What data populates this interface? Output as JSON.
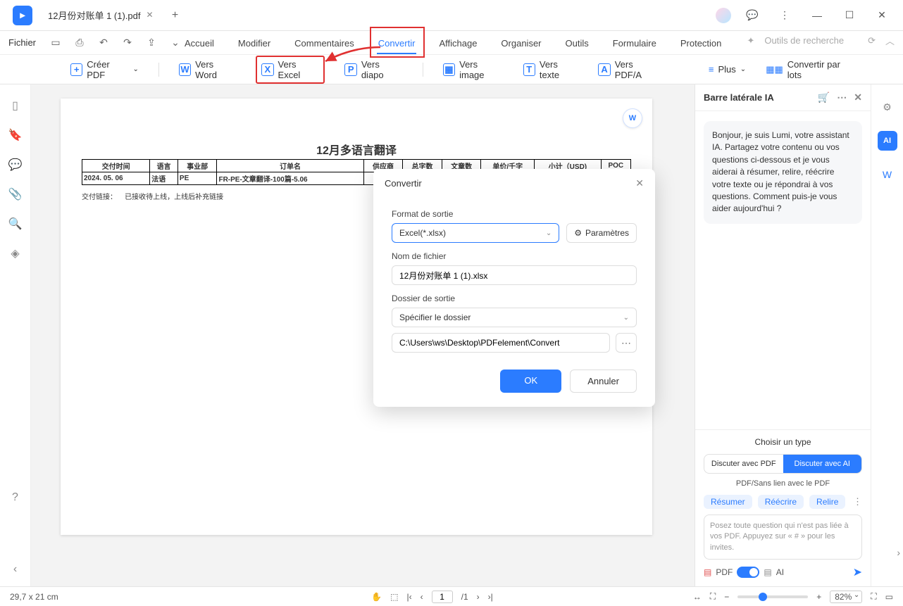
{
  "titlebar": {
    "tab_title": "12月份对账单 1 (1).pdf"
  },
  "quickbar": {
    "fichier": "Fichier"
  },
  "menu": {
    "items": [
      "Accueil",
      "Modifier",
      "Commentaires",
      "Convertir",
      "Affichage",
      "Organiser",
      "Outils",
      "Formulaire",
      "Protection"
    ],
    "active_index": 3,
    "search_placeholder": "Outils de recherche"
  },
  "toolbar": {
    "create": "Créer PDF",
    "word": "Vers Word",
    "excel": "Vers Excel",
    "diapo": "Vers diapo",
    "image": "Vers image",
    "texte": "Vers texte",
    "pdfa": "Vers PDF/A",
    "plus": "Plus",
    "parlots": "Convertir par lots"
  },
  "doc": {
    "title": "12月多语言翻译",
    "headers": [
      "交付时间",
      "语言",
      "事业部",
      "订单名",
      "供应商",
      "总字数",
      "文章数",
      "单价/千字",
      "小计（USD)",
      "POC"
    ],
    "row": [
      "2024. 05. 06",
      "法语",
      "PE",
      "FR-PE-文章翻译-100篇-5.06",
      "",
      "",
      "",
      "",
      "",
      ""
    ],
    "note_label": "交付链接：",
    "note_text": "已接收待上线，上线后补充链接"
  },
  "dialog": {
    "title": "Convertir",
    "format_label": "Format de sortie",
    "format_value": "Excel(*.xlsx)",
    "param": "Paramètres",
    "filename_label": "Nom de fichier",
    "filename_value": "12月份对账单 1 (1).xlsx",
    "folder_label": "Dossier de sortie",
    "folder_value": "Spécifier le dossier",
    "path_value": "C:\\Users\\ws\\Desktop\\PDFelement\\Convert",
    "ok": "OK",
    "cancel": "Annuler"
  },
  "ai": {
    "title": "Barre latérale IA",
    "greeting": "Bonjour, je suis Lumi, votre assistant IA. Partagez votre contenu ou vos questions ci-dessous et je vous aiderai à résumer, relire, réécrire votre texte ou je répondrai à vos questions. Comment puis-je vous aider aujourd'hui ?",
    "choose": "Choisir un type",
    "discuss_pdf": "Discuter avec PDF",
    "discuss_ai": "Discuter avec AI",
    "linknote": "PDF/Sans lien avec le PDF",
    "chips": [
      "Résumer",
      "Réécrire",
      "Relire"
    ],
    "placeholder": "Posez toute question qui n'est pas liée à vos PDF. Appuyez sur « # » pour les invites.",
    "pdf_label": "PDF",
    "ai_label": "AI"
  },
  "status": {
    "dimensions": "29,7 x 21 cm",
    "page_current": "1",
    "page_total": "/1",
    "zoom": "82%"
  },
  "chart_data": null
}
